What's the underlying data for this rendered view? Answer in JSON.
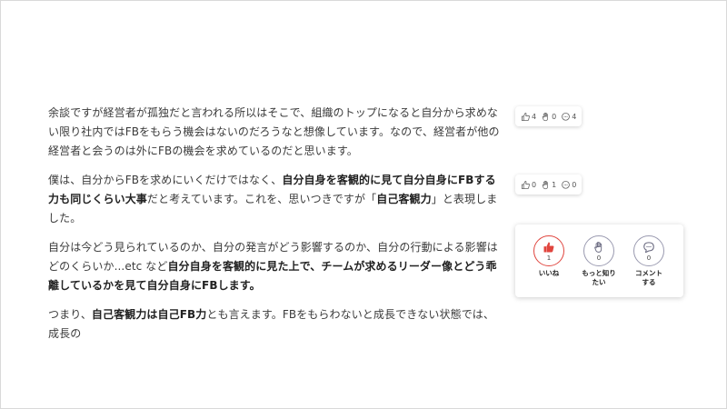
{
  "article": {
    "p1": "余談ですが経営者が孤独だと言われる所以はそこで、組織のトップになると自分から求めない限り社内ではFBをもらう機会はないのだろうなと想像しています。なので、経営者が他の経営者と会うのは外にFBの機会を求めているのだと思います。",
    "p2": {
      "a": "僕は、自分からFBを求めにいくだけではなく、",
      "b": "自分自身を客観的に見て自分自身にFBする力も同じくらい大事",
      "c": "だと考えています。これを、思いつきですが「",
      "d": "自己客観力",
      "e": "」と表現しました。"
    },
    "p3": {
      "a": "自分は今どう見られているのか、自分の発言がどう影響するのか、自分の行動による影響はどのくらいか...etc など",
      "b": "自分自身を客観的に見た上で、チームが求めるリーダー像とどう乖離しているかを見て自分自身にFBします。"
    },
    "p4": {
      "a": "つまり、",
      "b": "自己客観力は自己FB力",
      "c": "とも言えます。FBをもらわないと成長できない状態では、成長の"
    }
  },
  "reactions_p1": {
    "like": "4",
    "want_more": "0",
    "comment": "4"
  },
  "reactions_p2": {
    "like": "0",
    "want_more": "1",
    "comment": "0"
  },
  "reaction_panel": {
    "like": {
      "count": "1",
      "label": "いいね",
      "icon": "thumbs-up-icon"
    },
    "want_more": {
      "count": "0",
      "label_1": "もっと知り",
      "label_2": "たい",
      "icon": "raised-hand-icon"
    },
    "comment": {
      "count": "0",
      "label_1": "コメント",
      "label_2": "する",
      "icon": "speech-bubble-icon"
    }
  },
  "colors": {
    "active": "#e0453e",
    "outline": "#9a9ab0",
    "text": "#3a3a3a"
  }
}
